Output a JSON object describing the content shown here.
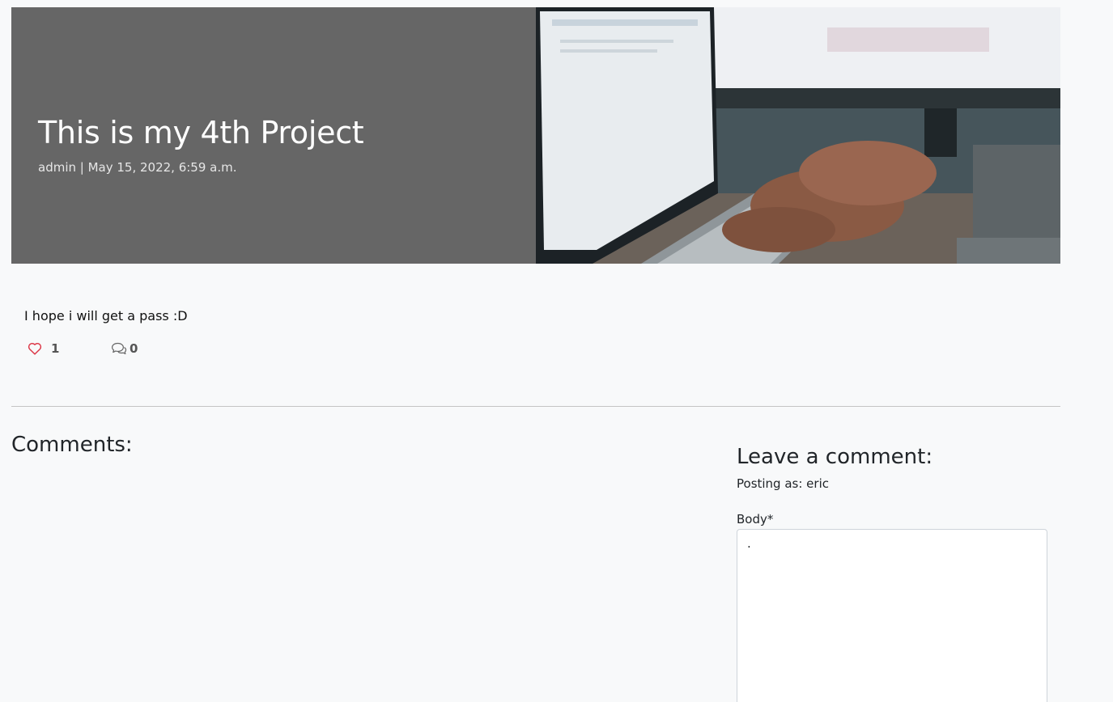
{
  "post": {
    "title": "This is my 4th Project",
    "meta": "admin | May 15, 2022, 6:59 a.m.",
    "content": "I hope i will get a pass :D",
    "likes": "1",
    "comment_count": "0"
  },
  "icons": {
    "like": "heart-icon",
    "comments": "chat-bubbles-icon"
  },
  "colors": {
    "masthead_bg": "#666666",
    "heart": "#dc3545",
    "page_bg": "#f8f9fa"
  },
  "comments": {
    "heading": "Comments:",
    "items": []
  },
  "comment_form": {
    "heading": "Leave a comment:",
    "posting_as": "Posting as: eric",
    "body_label": "Body*",
    "body_value": "."
  }
}
